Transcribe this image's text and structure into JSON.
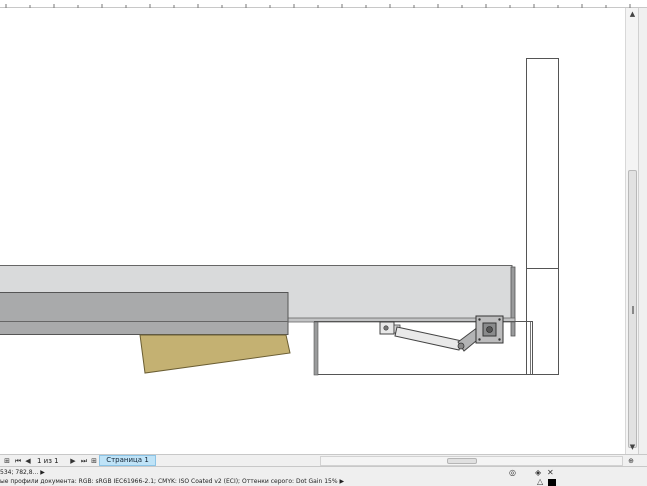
{
  "navigation": {
    "first_icon": "first-page-icon",
    "prev_icon": "prev-page-icon",
    "page_indicator": "1 из 1",
    "next_icon": "next-page-icon",
    "last_icon": "last-page-icon",
    "add_page_icon": "add-page-icon",
    "page_tab": "Страница 1"
  },
  "status": {
    "cursor_coords": "534; 782,8...",
    "color_profile": "ые профили документа: RGB: sRGB IEC61966-2.1; CMYK: ISO Coated v2 (ECI); Оттенки серого: Dot Gain 15%"
  },
  "colors": {
    "panel_light": "#d9dadb",
    "panel_mid": "#a9aaab",
    "wood": "#c4b172",
    "page_tab_bg": "#bfe3f7"
  }
}
